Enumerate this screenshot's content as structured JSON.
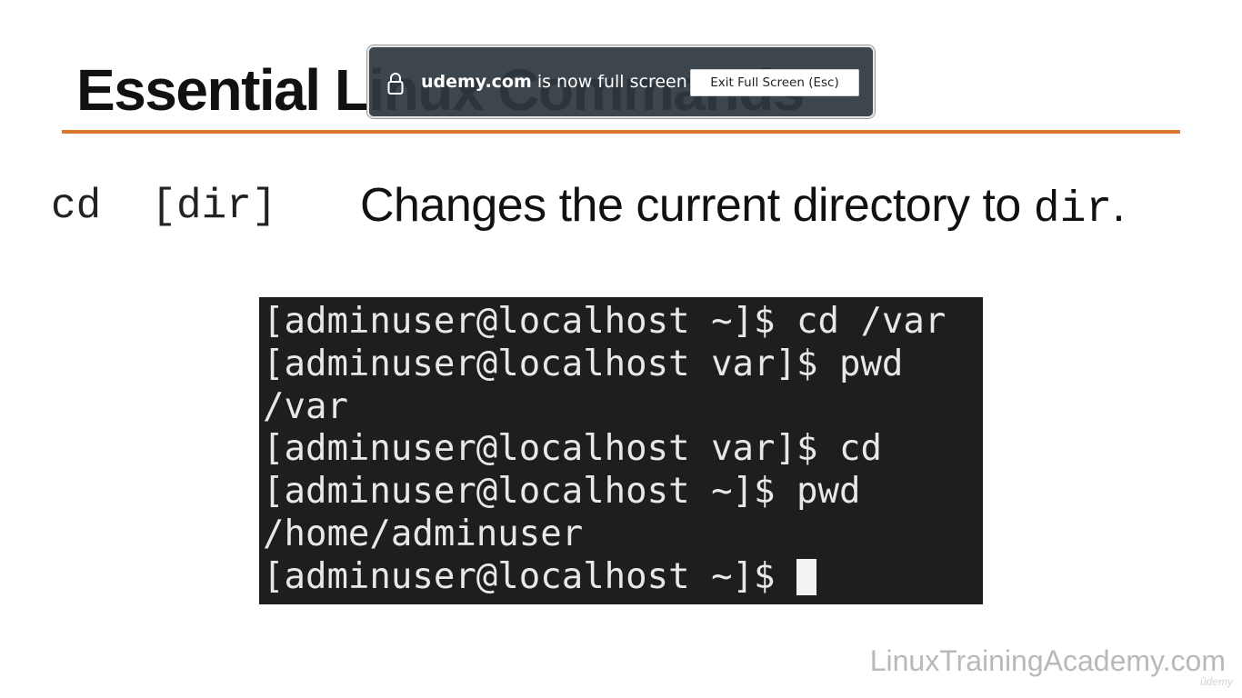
{
  "slide": {
    "title": "Essential Linux Commands",
    "command_syntax": "cd  [dir]",
    "description_prefix": "Changes the current directory to ",
    "description_code": "dir",
    "description_suffix": ".",
    "watermark": "LinuxTrainingAcademy.com",
    "udemy_mark": "ûdemy"
  },
  "terminal": {
    "lines": [
      "[adminuser@localhost ~]$ cd /var",
      "[adminuser@localhost var]$ pwd",
      "/var",
      "[adminuser@localhost var]$ cd",
      "[adminuser@localhost ~]$ pwd",
      "/home/adminuser",
      "[adminuser@localhost ~]$ "
    ]
  },
  "fullscreen_notice": {
    "lock_icon": "lock-icon",
    "domain": "udemy.com",
    "message": " is now full screen",
    "exit_button": "Exit Full Screen (Esc)"
  },
  "colors": {
    "accent_rule": "#d9782d",
    "terminal_bg": "#1e1e1e",
    "notice_bg": "#2f3840"
  }
}
